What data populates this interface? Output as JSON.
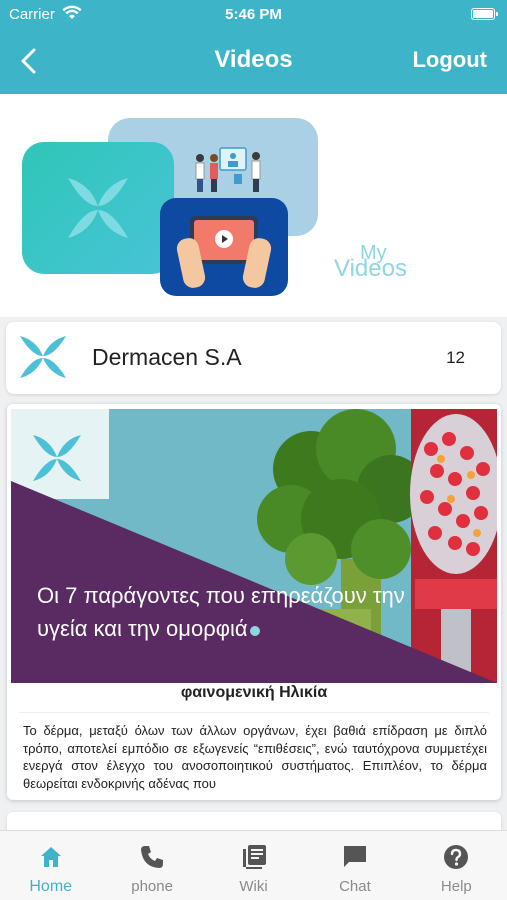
{
  "status_bar": {
    "carrier": "Carrier",
    "time": "5:46 PM"
  },
  "nav": {
    "title": "Videos",
    "logout_label": "Logout"
  },
  "banner": {
    "line1": "My",
    "line2": "Videos"
  },
  "company": {
    "name": "Dermacen S.A",
    "video_count": "12"
  },
  "video_card": {
    "thumbnail_headline": "Οι 7 παράγοντες που επηρεάζουν την υγεία και την ομορφιά",
    "subtitle": "φαινομενική Ηλικία",
    "description": "Το δέρμα, μεταξύ όλων των άλλων οργάνων, έχει βαθιά επίδραση με διπλό τρόπο, αποτελεί εμπόδιο σε εξωγενείς “επιθέσεις”, ενώ ταυτόχρονα συμμετέχει ενεργά στον έλεγχο του ανοσοποιητικού συστήματος. Επιπλέον, το δέρμα θεωρείται ενδοκρινής αδένας που"
  },
  "tabs": [
    {
      "label": "Home",
      "icon": "home-icon",
      "active": true
    },
    {
      "label": "phone",
      "icon": "phone-icon",
      "active": false
    },
    {
      "label": "Wiki",
      "icon": "wiki-icon",
      "active": false
    },
    {
      "label": "Chat",
      "icon": "chat-icon",
      "active": false
    },
    {
      "label": "Help",
      "icon": "help-icon",
      "active": false
    }
  ],
  "colors": {
    "accent": "#3eb4c9",
    "purple": "#5a2a62",
    "inactive": "#8a8a8a"
  }
}
